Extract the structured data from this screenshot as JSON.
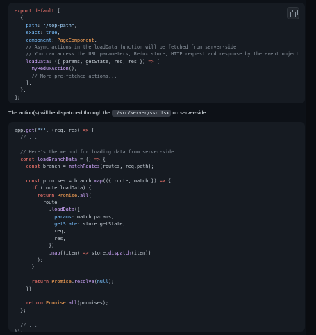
{
  "code_block_1": {
    "copy_button_label": "Copy",
    "lines": [
      [
        [
          "k",
          "export default"
        ],
        [
          "p",
          " ["
        ]
      ],
      [
        [
          "p",
          "  {"
        ]
      ],
      [
        [
          "p",
          "    "
        ],
        [
          "n",
          "path"
        ],
        [
          "p",
          ": "
        ],
        [
          "s",
          "\"/top-path\""
        ],
        [
          "p",
          ","
        ]
      ],
      [
        [
          "p",
          "    "
        ],
        [
          "n",
          "exact"
        ],
        [
          "p",
          ": "
        ],
        [
          "n",
          "true"
        ],
        [
          "p",
          ","
        ]
      ],
      [
        [
          "p",
          "    "
        ],
        [
          "n",
          "component"
        ],
        [
          "p",
          ": "
        ],
        [
          "o",
          "PageComponent"
        ],
        [
          "p",
          ","
        ]
      ],
      [
        [
          "c",
          "    // Async actions in the loadData function will be fetched from server-side"
        ]
      ],
      [
        [
          "c",
          "    // You can access the URL parameters, Redux store, HTTP request and response by the event object"
        ]
      ],
      [
        [
          "p",
          "    "
        ],
        [
          "f",
          "loadData"
        ],
        [
          "p",
          ": ({ params, getState, req, res }) "
        ],
        [
          "k",
          "=>"
        ],
        [
          "p",
          " ["
        ]
      ],
      [
        [
          "p",
          "      "
        ],
        [
          "f",
          "myReduxAction"
        ],
        [
          "p",
          "(),"
        ]
      ],
      [
        [
          "c",
          "      // More pre-fetched actions..."
        ]
      ],
      [
        [
          "p",
          "    ],"
        ]
      ],
      [
        [
          "p",
          "  },"
        ]
      ],
      [
        [
          "p",
          "];"
        ]
      ]
    ]
  },
  "prose": {
    "before": "The action(s) will be dispatched through the ",
    "code": "./src/server/ssr.tsx",
    "after": " on server-side:"
  },
  "code_block_2": {
    "lines": [
      [
        [
          "p",
          "app."
        ],
        [
          "f",
          "get"
        ],
        [
          "p",
          "("
        ],
        [
          "s",
          "\"*\""
        ],
        [
          "p",
          ", (req, res) "
        ],
        [
          "k",
          "=>"
        ],
        [
          "p",
          " {"
        ]
      ],
      [
        [
          "c",
          "  // ..."
        ]
      ],
      [
        [
          "p",
          " "
        ]
      ],
      [
        [
          "c",
          "  // Here's the method for loading data from server-side"
        ]
      ],
      [
        [
          "p",
          "  "
        ],
        [
          "k",
          "const"
        ],
        [
          "p",
          " "
        ],
        [
          "f",
          "loadBranchData"
        ],
        [
          "p",
          " = () "
        ],
        [
          "k",
          "=>"
        ],
        [
          "p",
          " {"
        ]
      ],
      [
        [
          "p",
          "    "
        ],
        [
          "k",
          "const"
        ],
        [
          "p",
          " branch = "
        ],
        [
          "f",
          "matchRoutes"
        ],
        [
          "p",
          "(routes, req.path);"
        ]
      ],
      [
        [
          "p",
          " "
        ]
      ],
      [
        [
          "p",
          "    "
        ],
        [
          "k",
          "const"
        ],
        [
          "p",
          " promises = branch."
        ],
        [
          "f",
          "map"
        ],
        [
          "p",
          "(({ route, match }) "
        ],
        [
          "k",
          "=>"
        ],
        [
          "p",
          " {"
        ]
      ],
      [
        [
          "p",
          "      "
        ],
        [
          "k",
          "if"
        ],
        [
          "p",
          " (route.loadData) {"
        ]
      ],
      [
        [
          "p",
          "        "
        ],
        [
          "k",
          "return"
        ],
        [
          "p",
          " "
        ],
        [
          "o",
          "Promise"
        ],
        [
          "p",
          "."
        ],
        [
          "f",
          "all"
        ],
        [
          "p",
          "("
        ]
      ],
      [
        [
          "p",
          "          route"
        ]
      ],
      [
        [
          "p",
          "            ."
        ],
        [
          "f",
          "loadData"
        ],
        [
          "p",
          "({"
        ]
      ],
      [
        [
          "p",
          "              "
        ],
        [
          "n",
          "params"
        ],
        [
          "p",
          ": match.params,"
        ]
      ],
      [
        [
          "p",
          "              "
        ],
        [
          "n",
          "getState"
        ],
        [
          "p",
          ": store.getState,"
        ]
      ],
      [
        [
          "p",
          "              req,"
        ]
      ],
      [
        [
          "p",
          "              res,"
        ]
      ],
      [
        [
          "p",
          "            })"
        ]
      ],
      [
        [
          "p",
          "            ."
        ],
        [
          "f",
          "map"
        ],
        [
          "p",
          "((item) "
        ],
        [
          "k",
          "=>"
        ],
        [
          "p",
          " store."
        ],
        [
          "f",
          "dispatch"
        ],
        [
          "p",
          "(item))"
        ]
      ],
      [
        [
          "p",
          "        );"
        ]
      ],
      [
        [
          "p",
          "      }"
        ]
      ],
      [
        [
          "p",
          " "
        ]
      ],
      [
        [
          "p",
          "      "
        ],
        [
          "k",
          "return"
        ],
        [
          "p",
          " "
        ],
        [
          "o",
          "Promise"
        ],
        [
          "p",
          "."
        ],
        [
          "f",
          "resolve"
        ],
        [
          "p",
          "("
        ],
        [
          "n",
          "null"
        ],
        [
          "p",
          ");"
        ]
      ],
      [
        [
          "p",
          "    });"
        ]
      ],
      [
        [
          "p",
          " "
        ]
      ],
      [
        [
          "p",
          "    "
        ],
        [
          "k",
          "return"
        ],
        [
          "p",
          " "
        ],
        [
          "o",
          "Promise"
        ],
        [
          "p",
          "."
        ],
        [
          "f",
          "all"
        ],
        [
          "p",
          "(promises);"
        ]
      ],
      [
        [
          "p",
          "  };"
        ]
      ],
      [
        [
          "p",
          " "
        ]
      ],
      [
        [
          "c",
          "  // ..."
        ]
      ],
      [
        [
          "p",
          "});"
        ]
      ]
    ]
  },
  "colors": {
    "background": "#0d1117",
    "code_background": "#161b22",
    "keyword": "#ff7b72",
    "string": "#a5d6ff",
    "comment": "#8b949e",
    "function": "#d2a8ff",
    "constant": "#79c0ff",
    "class": "#ffa657"
  }
}
